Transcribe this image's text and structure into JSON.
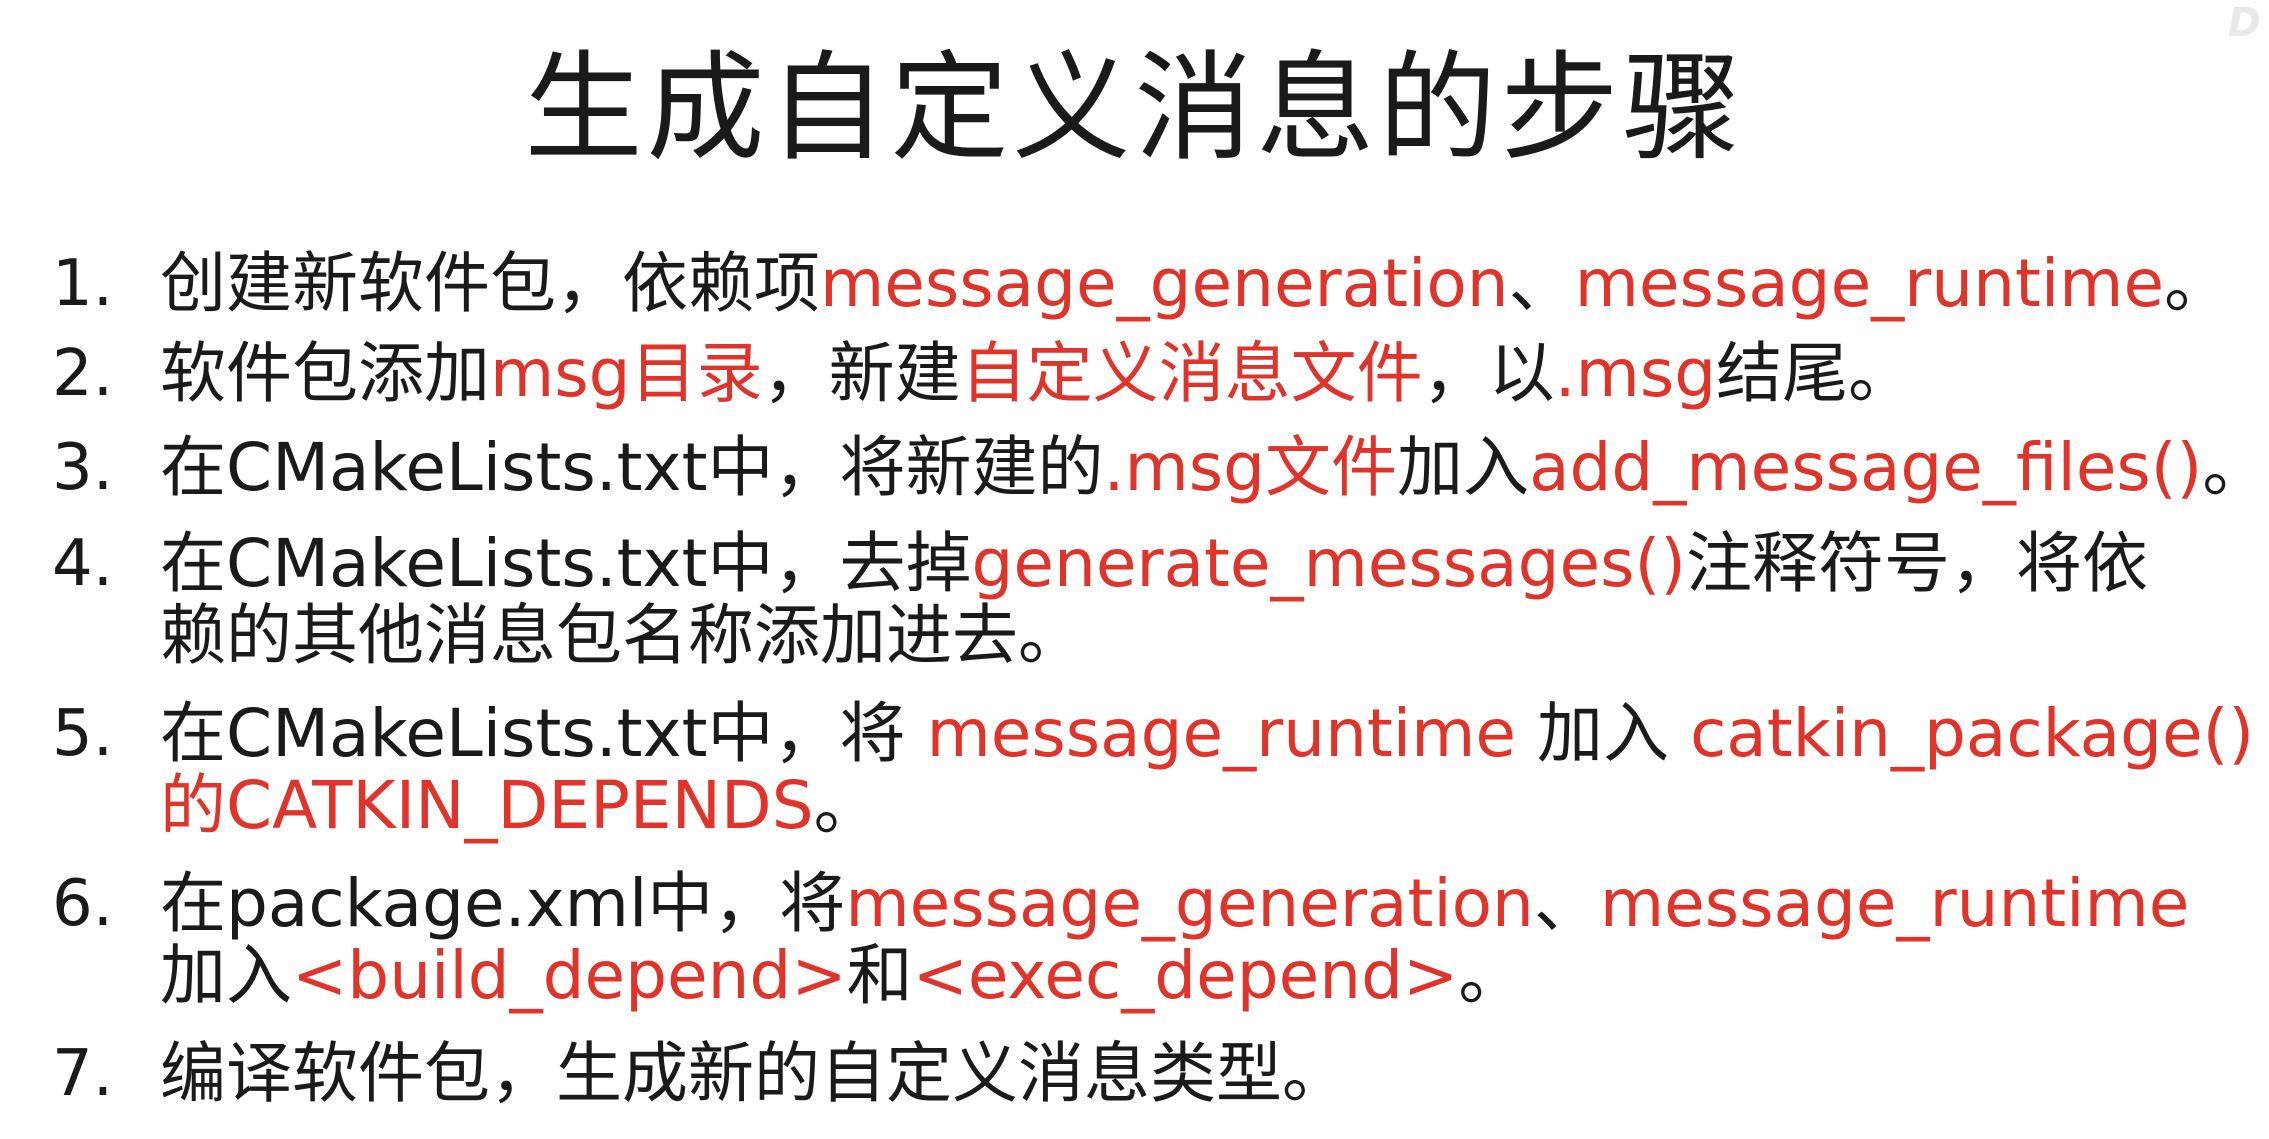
{
  "title": "生成自定义消息的步骤",
  "steps": [
    {
      "number": "1.",
      "lines": [
        [
          {
            "text": "创建新软件包，依赖项",
            "red": false
          },
          {
            "text": "message_generation",
            "red": true
          },
          {
            "text": "、",
            "red": false
          },
          {
            "text": "message_runtime",
            "red": true
          },
          {
            "text": "。",
            "red": false
          }
        ]
      ]
    },
    {
      "number": "2.",
      "lines": [
        [
          {
            "text": "软件包添加",
            "red": false
          },
          {
            "text": "msg目录",
            "red": true
          },
          {
            "text": "，新建",
            "red": false
          },
          {
            "text": "自定义消息文件",
            "red": true
          },
          {
            "text": "，以",
            "red": false
          },
          {
            "text": ".msg",
            "red": true
          },
          {
            "text": "结尾。",
            "red": false
          }
        ]
      ]
    },
    {
      "number": "3.",
      "lines": [
        [
          {
            "text": "在CMakeLists.txt中，将新建的",
            "red": false
          },
          {
            "text": ".msg文件",
            "red": true
          },
          {
            "text": "加入",
            "red": false
          },
          {
            "text": "add_message_files()",
            "red": true
          },
          {
            "text": "。",
            "red": false
          }
        ]
      ]
    },
    {
      "number": "4.",
      "lines": [
        [
          {
            "text": "在CMakeLists.txt中，去掉",
            "red": false
          },
          {
            "text": "generate_messages()",
            "red": true
          },
          {
            "text": "注释符号，将依",
            "red": false
          }
        ],
        [
          {
            "text": "赖的其他消息包名称添加进去。",
            "red": false
          }
        ]
      ]
    },
    {
      "number": "5.",
      "lines": [
        [
          {
            "text": "在CMakeLists.txt中，将 ",
            "red": false
          },
          {
            "text": "message_runtime",
            "red": true
          },
          {
            "text": " 加入 ",
            "red": false
          },
          {
            "text": "catkin_package()",
            "red": true
          }
        ],
        [
          {
            "text": "的CATKIN_DEPENDS",
            "red": true
          },
          {
            "text": "。",
            "red": false
          }
        ]
      ]
    },
    {
      "number": "6.",
      "lines": [
        [
          {
            "text": "在package.xml中，将",
            "red": false
          },
          {
            "text": "message_generation",
            "red": true
          },
          {
            "text": "、",
            "red": false
          },
          {
            "text": "message_runtime",
            "red": true
          }
        ],
        [
          {
            "text": "加入",
            "red": false
          },
          {
            "text": "<build_depend>",
            "red": true
          },
          {
            "text": "和",
            "red": false
          },
          {
            "text": "<exec_depend>",
            "red": true
          },
          {
            "text": "。",
            "red": false
          }
        ]
      ]
    },
    {
      "number": "7.",
      "lines": [
        [
          {
            "text": "编译软件包，生成新的自定义消息类型。",
            "red": false
          }
        ]
      ]
    }
  ],
  "colors": {
    "accent_red": "#e0342a",
    "text": "#1a1a1a",
    "background": "#ffffff"
  }
}
